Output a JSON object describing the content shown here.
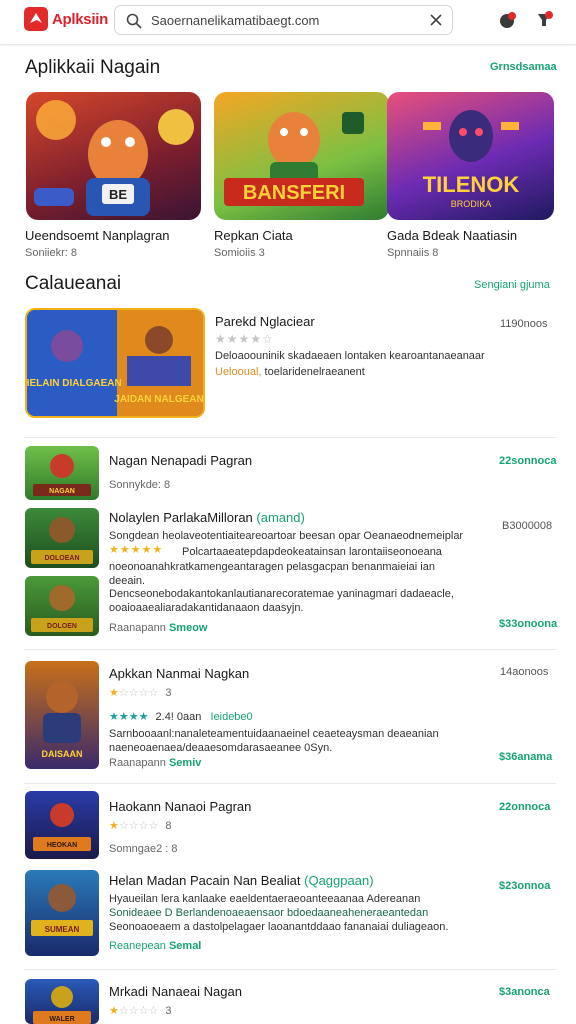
{
  "topbar": {
    "brand": "Aplksiin",
    "search_value": "Saoernanelikamatibaegt.com"
  },
  "section1": {
    "title": "Aplikkaii Nagain",
    "link": "Grnsdsamaa",
    "cards": [
      {
        "title": "Ueendsoemt Nanplagran",
        "sub": "Soniiekr: 8",
        "badge": "BE"
      },
      {
        "title": "Repkan Ciata",
        "sub": "Somioiis 3",
        "overlay": "BANSFERI"
      },
      {
        "title": "Gada Bdeak Naatiasin",
        "sub": "Spnnaiis 8",
        "overlay": "TILENOK",
        "overlay_sub": "BRODIKA"
      }
    ]
  },
  "section2": {
    "title": "Calaueanai",
    "link": "Sengiani gjuma",
    "hero": {
      "title": "Parekd Nglaciear",
      "stamp": "1190noos",
      "desc1": "Deloaoouninik skadaeaen lontaken kearoantanaeanaar",
      "desc2_a": "Uelooual,",
      "desc2_b": "toelaridenelraeanent",
      "art_left": "HELAIN DIALGAEAN",
      "art_right": "JAIDAN NALGEAN"
    }
  },
  "list": [
    {
      "title": "Nagan Nenapadi Pagran",
      "meta": "Sonnykde: 8",
      "price": "22sonnoca",
      "thumb_label": "NAGAN"
    },
    {
      "title": "Nolaylen ParlakaMilloran",
      "title_tag": "(amand)",
      "stamp": "B3000008",
      "desc": [
        "Songdean heolaveotentiaiteareoartoar beesan opar Oeanaeodnemeiplar",
        "Polcartaaeatepdapdeokeatainsan larontaiiseonoeana",
        "noeonoanahkratkamengeantaragen pelasgacpan benanmaieiai ian deeain.",
        "Dencseonebodakantokanlautianarecoratemae yaninagmari dadaeacle, ooaioaaealiaradakantidanaaon daasyjn."
      ],
      "link": "Raanapann",
      "link2": "Smeow",
      "price": "$33onoona",
      "thumb_label": "DOLOEAN",
      "thumb2_label": "DOLOEN"
    },
    {
      "title": "Apkkan Nanmai Nagkan",
      "meta": "3",
      "stamp": "14aonoos",
      "rating_text": "2.4! 0aan",
      "rating_extra": "Ieidebe0",
      "desc": [
        "Sarnbooaanl:nanaleteamentuidaanaeinel ceaeteaysman deaeanian",
        "naeneoaenaea/deaaesomdarasaeanee 0Syn."
      ],
      "link": "Raanapann",
      "link2": "Semiv",
      "price": "$36anama",
      "thumb_label": "DAISAAN"
    },
    {
      "title": "Haokann Nanaoi Pagran",
      "meta": "8",
      "price": "22onnoca",
      "sub": "Somngae2 : 8",
      "thumb_label": "HEOKAN"
    },
    {
      "title": "Helan Madan Pacain Nan Bealiat",
      "title_tag": "(Qaggpaan)",
      "price": "$23onnoa",
      "desc": [
        "Hyaueilan lera kanlaake eaeldentaeraeoanteeaanaa Adereanan",
        "Sonideaee D Berlandenoaeaensaor bdoedaaneaheneraeantedan",
        "Seonoaoeaem a dastolpelagaer laoanantddaao fananaiai duliageaon."
      ],
      "link": "Reanepean",
      "link2": "Semal",
      "thumb_label": "SUMEAN"
    },
    {
      "title": "Mrkadi Nanaeai Nagan",
      "meta": "3",
      "price": "$3anonca",
      "thumb_label": "WALER"
    }
  ],
  "colors": {
    "accent_green": "#17a273",
    "brand_red": "#d9232d",
    "star_gold": "#f3b21a"
  },
  "icons": [
    "app-logo-icon",
    "search-icon",
    "close-icon",
    "notification-icon",
    "download-icon",
    "star-icon"
  ]
}
